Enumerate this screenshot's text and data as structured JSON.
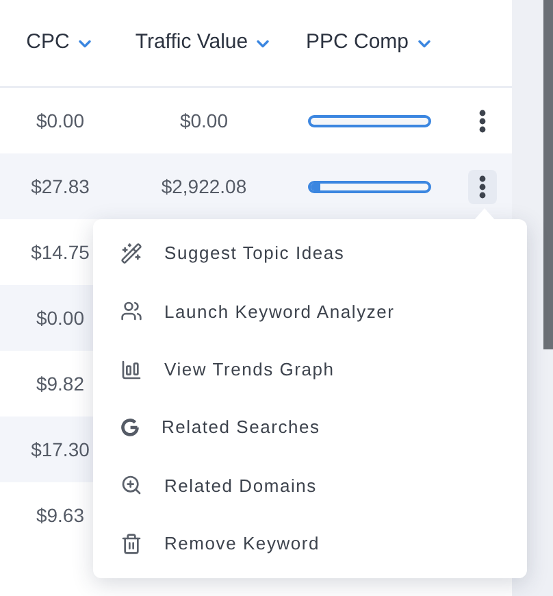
{
  "columns": [
    {
      "label": "CPC"
    },
    {
      "label": "Traffic Value"
    },
    {
      "label": "PPC Comp"
    }
  ],
  "rows": [
    {
      "cpc": "$0.00",
      "traffic_value": "$0.00",
      "ppc_comp": {
        "level": 0
      },
      "menu_open": false
    },
    {
      "cpc": "$27.83",
      "traffic_value": "$2,922.08",
      "ppc_comp": {
        "level": 0.08
      },
      "menu_open": true
    },
    {
      "cpc": "$14.75"
    },
    {
      "cpc": "$0.00"
    },
    {
      "cpc": "$9.82"
    },
    {
      "cpc": "$17.30"
    },
    {
      "cpc": "$9.63"
    }
  ],
  "menu": {
    "items": [
      {
        "kind": "wand",
        "label": "Suggest Topic Ideas"
      },
      {
        "kind": "people",
        "label": "Launch Keyword Analyzer"
      },
      {
        "kind": "chart",
        "label": "View Trends Graph"
      },
      {
        "kind": "google",
        "label": "Related Searches"
      },
      {
        "kind": "zoom",
        "label": "Related Domains"
      },
      {
        "kind": "trash",
        "label": "Remove Keyword"
      }
    ]
  }
}
